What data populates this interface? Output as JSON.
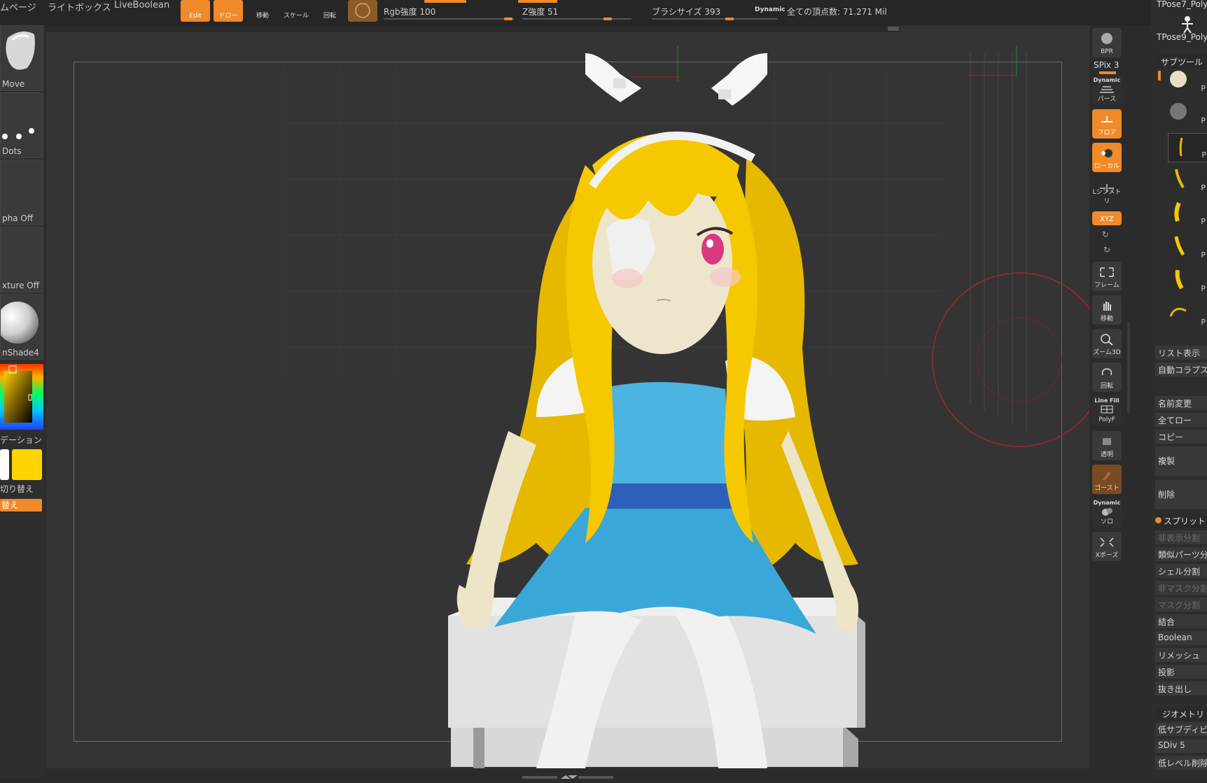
{
  "topbar": {
    "page_label": "ムページ",
    "lightbox_label": "ライトボックス",
    "liveboolean_label": "LiveBoolean",
    "edit_label": "Edit",
    "draw_label": "ドロー",
    "move_label": "移動",
    "scale_label": "スケール",
    "rotate_label": "回転",
    "rgb_intensity": "Rgb強度 100",
    "z_intensity": "Z強度 51",
    "brush_size": "ブラシサイズ 393",
    "dynamic_label": "Dynamic",
    "total_vertices": "全ての頂点数: 71.271 Mil"
  },
  "left_shelf": {
    "brush_label": "Move",
    "stroke_label": "Dots",
    "alpha_label": "pha Off",
    "texture_label": "xture Off",
    "material_label": "nShade4",
    "gradient_label": "デーション",
    "switch_label": "切り替え",
    "switch_button_label": "替え",
    "main_color": "#ffd400",
    "secondary_color": "#ffffff"
  },
  "right_tools": {
    "bpr": "BPR",
    "spix": "SPix 3",
    "dynamic": "Dynamic",
    "persp": "パース",
    "floor": "フロア",
    "local": "ローカル",
    "symmetry": "Lシンメトリ",
    "xyz": "XYZ",
    "frame": "フレーム",
    "move": "移動",
    "zoom3d": "ズーム3D",
    "rotate": "回転",
    "linefill": "Line Fill",
    "polyf": "PolyF",
    "transp": "透明",
    "ghost": "ゴースト",
    "solo_dynamic": "Dynamic",
    "solo": "ソロ",
    "xpose": "Xポーズ"
  },
  "right_panel": {
    "tool_items": [
      "TPose7_Poly",
      "TPose9_Poly"
    ],
    "subtool_header": "サブツール",
    "subtool_p": "P",
    "list_view": "リスト表示",
    "auto_collapse": "自動コラプス",
    "rename": "名前変更",
    "all_low": "全てロー",
    "copy": "コピー",
    "duplicate": "複製",
    "delete": "削除",
    "split_header": "スプリット",
    "split_hidden": "非表示分割",
    "split_similar": "類似パーツ分",
    "split_shell": "シェル分割",
    "split_unmasked": "非マスク分割",
    "split_mask": "マスク分割",
    "merge": "結合",
    "boolean": "Boolean",
    "remesh": "リメッシュ",
    "project": "投影",
    "extract": "抜き出し",
    "geometry_header": "ジオメトリ",
    "lower_subdiv": "低サブディビ",
    "sdiv": "SDiv 5",
    "del_lower": "低レベル削除"
  }
}
